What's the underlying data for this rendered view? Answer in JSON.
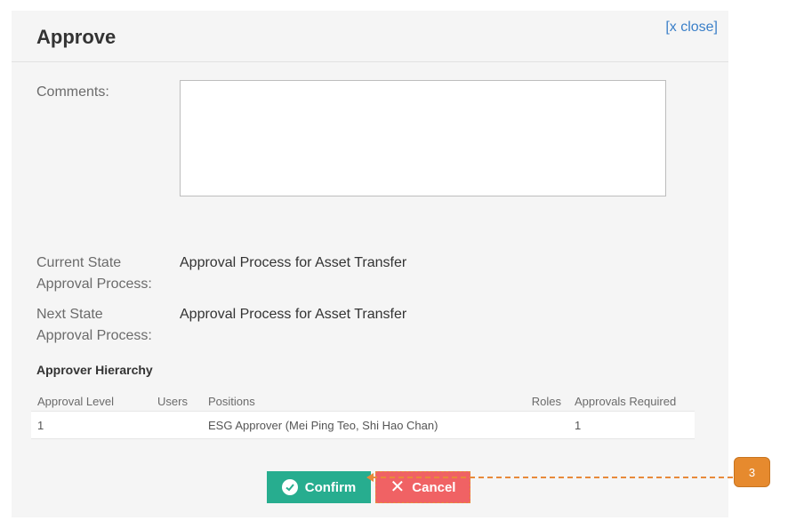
{
  "dialog": {
    "title": "Approve",
    "close_label": "[x close]"
  },
  "form": {
    "comments_label": "Comments:",
    "comments_value": "",
    "current_state_label_1": "Current State",
    "current_state_label_2": "Approval Process:",
    "current_state_value": "Approval Process for Asset Transfer",
    "next_state_label_1": "Next State",
    "next_state_label_2": "Approval Process:",
    "next_state_value": "Approval Process for Asset Transfer"
  },
  "hierarchy": {
    "heading": "Approver Hierarchy",
    "columns": [
      "Approval Level",
      "Users",
      "Positions",
      "Roles",
      "Approvals Required"
    ],
    "rows": [
      {
        "level": "1",
        "users": "",
        "positions": "ESG Approver (Mei Ping Teo, Shi Hao Chan)",
        "roles": "",
        "approvals_required": "1"
      }
    ]
  },
  "actions": {
    "confirm_label": "Confirm",
    "cancel_label": "Cancel"
  },
  "callout": {
    "number": "3",
    "color": "#e68a2e"
  },
  "icons": {
    "confirm": "check-circle-icon",
    "cancel": "close-icon"
  },
  "colors": {
    "confirm": "#27ad8f",
    "cancel": "#f06264",
    "link": "#3a7fc8"
  }
}
